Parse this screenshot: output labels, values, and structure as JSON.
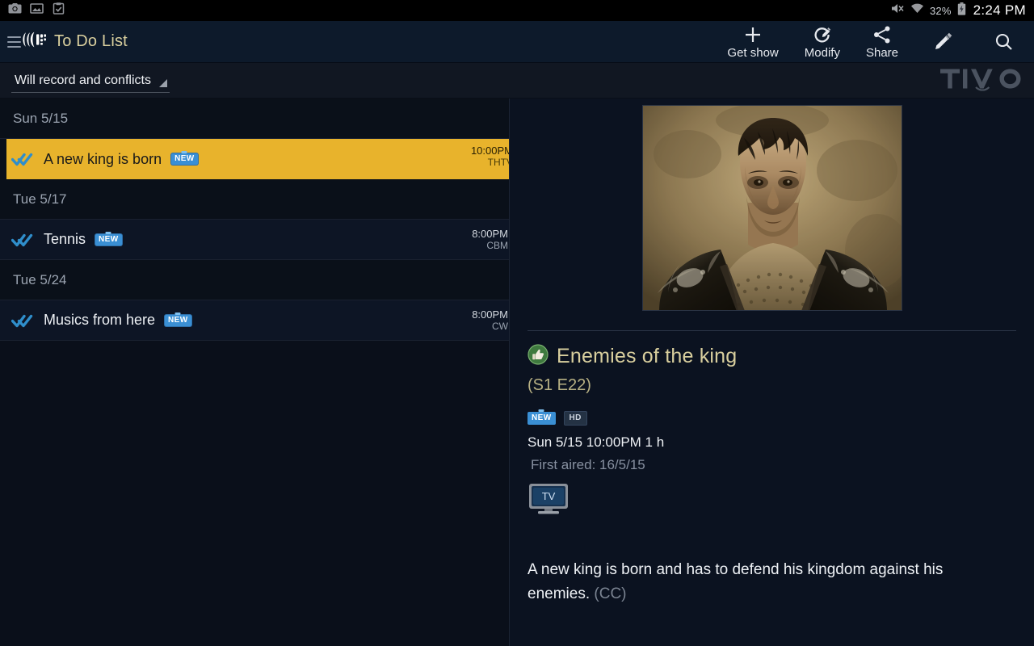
{
  "status_bar": {
    "icons": [
      "camera-icon",
      "image-icon",
      "clipboard-check-icon"
    ],
    "mute_icon": "volume-mute-icon",
    "wifi_icon": "wifi-icon",
    "battery_percent": "32%",
    "battery_icon": "battery-charging-icon",
    "clock": "2:24 PM"
  },
  "action_bar": {
    "menu_icon": "hamburger-menu-icon",
    "logo_icon": "tivo-logo-icon",
    "title": "To Do List",
    "actions": [
      {
        "label": "Get show",
        "icon": "plus-icon"
      },
      {
        "label": "Modify",
        "icon": "modify-record-icon"
      },
      {
        "label": "Share",
        "icon": "share-icon"
      }
    ],
    "edit_icon": "pencil-icon",
    "search_icon": "search-icon"
  },
  "sub_bar": {
    "filter_label": "Will record and conflicts",
    "caret_icon": "dropdown-caret-icon",
    "brand_wordmark": "TiVo"
  },
  "list": {
    "groups": [
      {
        "date": "Sun 5/15",
        "rows": [
          {
            "title": "A new king is born",
            "badge": "NEW",
            "time": "10:00PM",
            "channel": "THTV",
            "selected": true,
            "record_icon": "double-check-record-icon"
          }
        ]
      },
      {
        "date": "Tue 5/17",
        "rows": [
          {
            "title": "Tennis",
            "badge": "NEW",
            "time": "8:00PM",
            "channel": "CBM",
            "selected": false,
            "record_icon": "double-check-record-icon"
          }
        ]
      },
      {
        "date": "Tue 5/24",
        "rows": [
          {
            "title": "Musics from here",
            "badge": "NEW",
            "time": "8:00PM",
            "channel": "CW",
            "selected": false,
            "record_icon": "double-check-record-icon"
          }
        ]
      }
    ]
  },
  "detail": {
    "hero_alt": "warrior-in-black-armor-photo",
    "thumb_icon": "thumbs-up-icon",
    "title": "Enemies of the king",
    "episode": "(S1 E22)",
    "badges": {
      "new": "NEW",
      "hd": "HD"
    },
    "when": "Sun 5/15 10:00PM 1 h",
    "first_aired": "First aired: 16/5/15",
    "source_icon": "tv-monitor-icon",
    "source_label": "TV",
    "description": "A new king is born and has to defend his kingdom against his enemies.",
    "cc": "(CC)"
  },
  "colors": {
    "accent_gold": "#e8b32c",
    "title_gold": "#d9cf9e",
    "badge_blue": "#3a8fd4",
    "bg_dark": "#0b1220",
    "bar_dark": "#0d1a2b"
  }
}
